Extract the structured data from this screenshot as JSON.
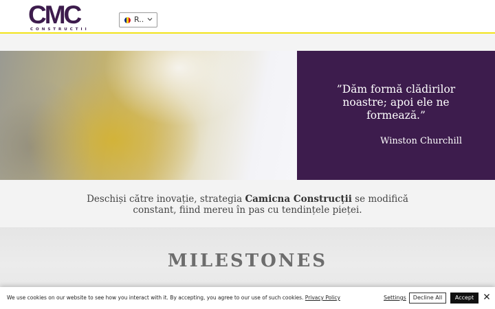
{
  "header": {
    "logo_text": "CMC",
    "logo_subtext": "CONSTRUCTII",
    "language": {
      "selected": "R..",
      "flag_colors": [
        "#002b7f",
        "#fcd116",
        "#ce1126"
      ]
    }
  },
  "hero": {
    "quote": "”Dăm formă clădirilor noastre; apoi ele ne formează.”",
    "author": "Winston Churchill"
  },
  "intro": {
    "text_before": "Deschiși către inovație, strategia ",
    "brand": "Camicna Construcții",
    "text_after": " se modifică constant, fiind mereu în pas cu tendințele pieței."
  },
  "milestones": {
    "title": "MILESTONES"
  },
  "cookie_banner": {
    "message": "We use cookies on our website to see how you interact with it. By accepting, you agree to our use of such cookies.",
    "policy_link": "Privacy Policy",
    "settings_label": "Settings",
    "decline_label": "Decline All",
    "accept_label": "Accept"
  },
  "colors": {
    "brand_purple": "#3d1c4d",
    "accent_yellow": "#f2e318"
  }
}
